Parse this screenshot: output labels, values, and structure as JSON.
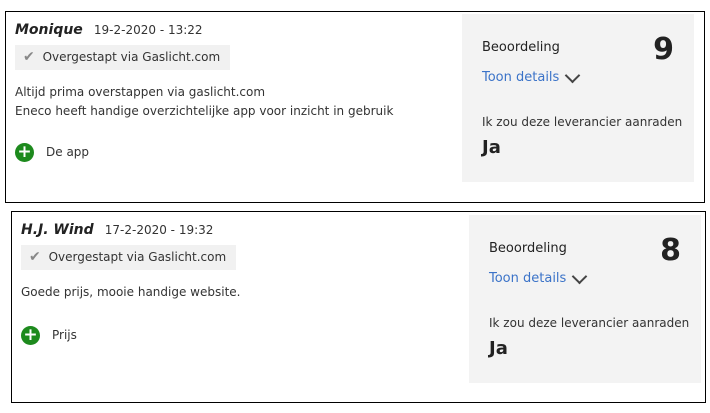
{
  "reviews": [
    {
      "author": "Monique",
      "date": "19-2-2020 - 13:22",
      "badge": "Overgestapt via Gaslicht.com",
      "text_lines": [
        "Altijd prima overstappen via gaslicht.com",
        "Eneco heeft handige overzichtelijke app voor inzicht in gebruik"
      ],
      "pro": "De app",
      "rating_label": "Beoordeling",
      "score": "9",
      "details_label": "Toon details",
      "recommend_label": "Ik zou deze leverancier aanraden",
      "recommend_value": "Ja"
    },
    {
      "author": "H.J. Wind",
      "date": "17-2-2020 - 19:32",
      "badge": "Overgestapt via Gaslicht.com",
      "text_lines": [
        "Goede prijs, mooie handige website."
      ],
      "pro": "Prijs",
      "rating_label": "Beoordeling",
      "score": "8",
      "details_label": "Toon details",
      "recommend_label": "Ik zou deze leverancier aanraden",
      "recommend_value": "Ja"
    }
  ]
}
